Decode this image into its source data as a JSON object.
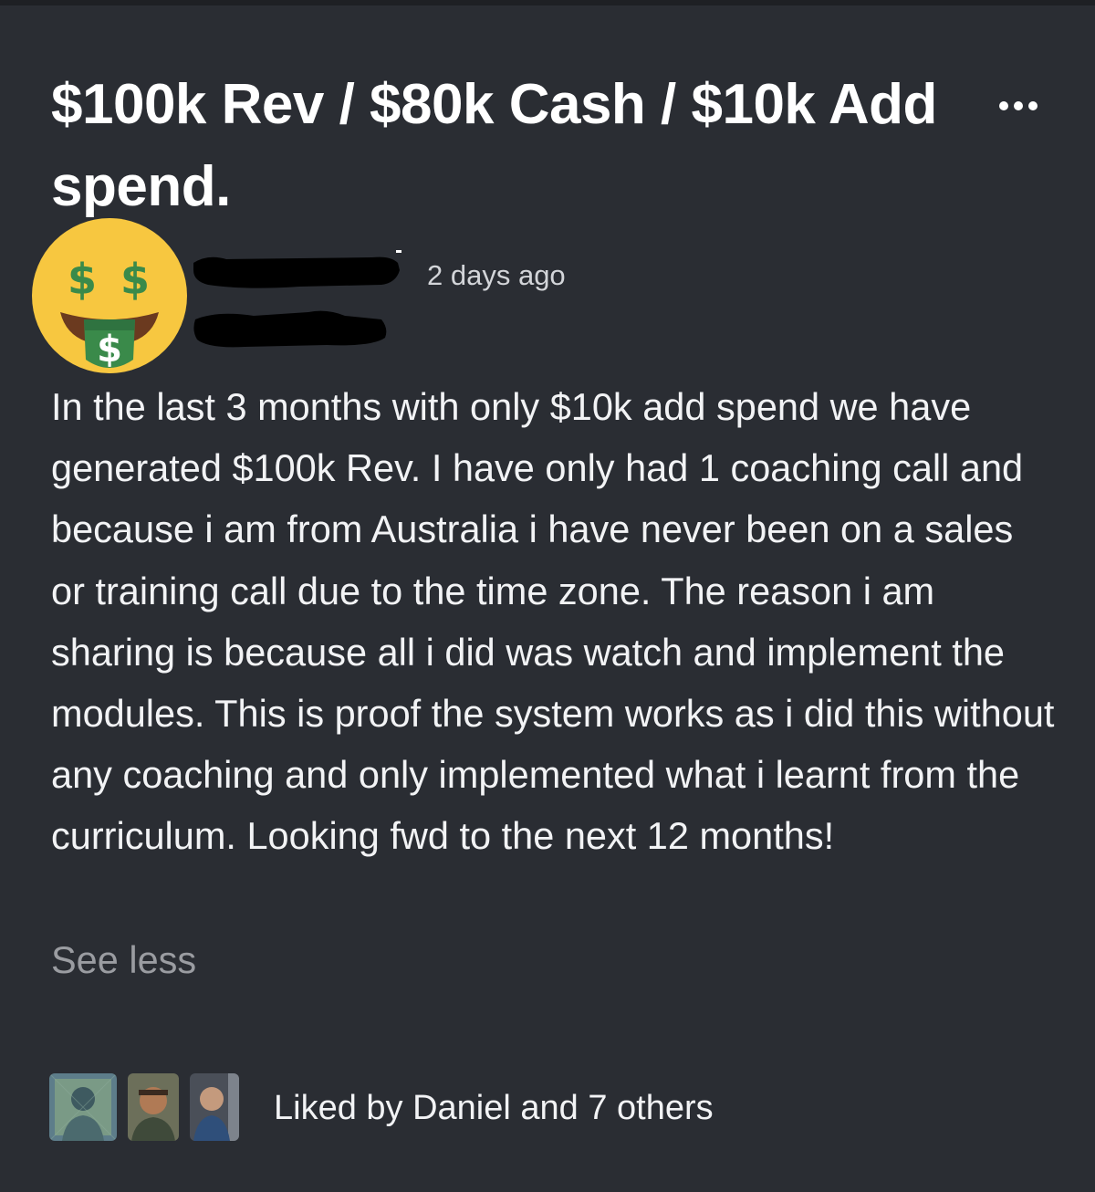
{
  "post": {
    "title": "$100k Rev / $80k Cash / $10k Add spend.",
    "timestamp": "2 days ago",
    "body": "In the last 3 months with only $10k add spend we have generated $100k Rev. I have only had 1 coaching call and because i am from Australia i have never been on a sales or training call due to the time zone. The reason i am sharing is because all i did was watch and implement the modules. This is proof the system works as i did this without any coaching and only implemented what i learnt from the curriculum. Looking fwd to the next 12 months!",
    "see_less_label": "See less",
    "author_avatar_icon": "money-mouth-face-icon",
    "more_icon": "more-options-icon"
  },
  "likes": {
    "text": "Liked by Daniel and 7 others",
    "liker_count_shown": 3
  },
  "colors": {
    "background": "#2a2d33",
    "text_primary": "#f2f3f5",
    "text_secondary": "#d3d5d9",
    "text_muted": "#9a9ca1",
    "emoji_face": "#f7c740",
    "emoji_money": "#3a8a4a"
  }
}
